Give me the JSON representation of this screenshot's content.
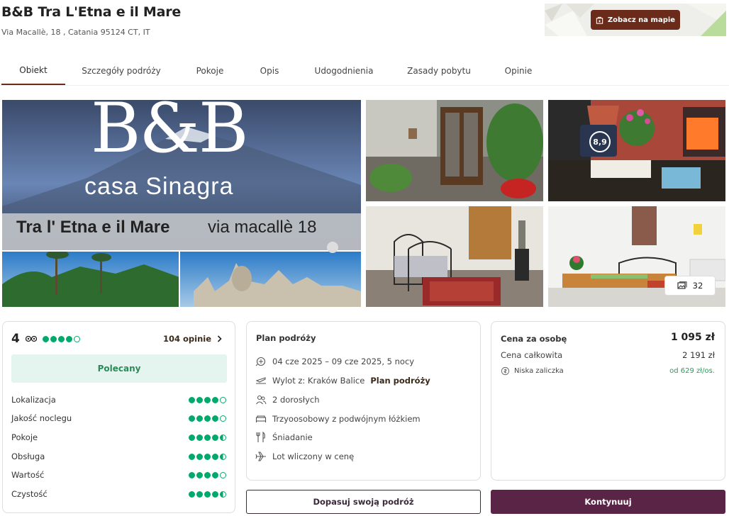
{
  "hotel": {
    "name": "B&B Tra L'Etna e il Mare",
    "address": "Via Macallè, 18 , Catania 95124 CT, IT"
  },
  "map": {
    "button_label": "Zobacz na mapie",
    "icon": "map-pin-icon"
  },
  "tabs": [
    {
      "label": "Obiekt",
      "active": true
    },
    {
      "label": "Szczegóły podróży"
    },
    {
      "label": "Pokoje"
    },
    {
      "label": "Opis"
    },
    {
      "label": "Udogodnienia"
    },
    {
      "label": "Zasady pobytu"
    },
    {
      "label": "Opinie"
    }
  ],
  "gallery": {
    "main_sign": {
      "line1": "B&B",
      "line2": "casa Sinagra",
      "line3": "Tra l' Etna e il Mare",
      "line4": "via macallè 18"
    },
    "photo_count": "32",
    "review_badge": "8,9"
  },
  "ratings": {
    "score": "4",
    "score_dots": 4,
    "reviews_link": "104 opinie",
    "recommended": "Polecany",
    "categories": [
      {
        "label": "Lokalizacja",
        "value": 4
      },
      {
        "label": "Jakość noclegu",
        "value": 4
      },
      {
        "label": "Pokoje",
        "value": 4.5
      },
      {
        "label": "Obsługa",
        "value": 4.5
      },
      {
        "label": "Wartość",
        "value": 4
      },
      {
        "label": "Czystość",
        "value": 4.5
      }
    ]
  },
  "plan": {
    "title": "Plan podróży",
    "items": [
      {
        "icon": "calendar-icon",
        "text": "04 cze 2025 – 09 cze 2025, 5 nocy"
      },
      {
        "icon": "plane-departure-icon",
        "text": "Wylot z: Kraków Balice",
        "extra": "Plan podróży"
      },
      {
        "icon": "people-icon",
        "text": "2 dorosłych"
      },
      {
        "icon": "bed-icon",
        "text": "Trzyoosobowy z podwójnym łóżkiem"
      },
      {
        "icon": "cutlery-icon",
        "text": "Śniadanie"
      },
      {
        "icon": "plane-icon",
        "text": "Lot wliczony w cenę"
      }
    ]
  },
  "price": {
    "per_person_label": "Cena za osobę",
    "per_person_value": "1 095 zł",
    "total_label": "Cena całkowita",
    "total_value": "2 191 zł",
    "deposit_label": "Niska zaliczka",
    "deposit_value": "od 629 zł/os."
  },
  "actions": {
    "customize": "Dopasuj swoją podróż",
    "continue": "Kontynuuj"
  },
  "colors": {
    "brand": "#6b2b1a",
    "accent": "#5a2447",
    "green": "#00aa6c",
    "recommended_bg": "#e3f5ee"
  }
}
